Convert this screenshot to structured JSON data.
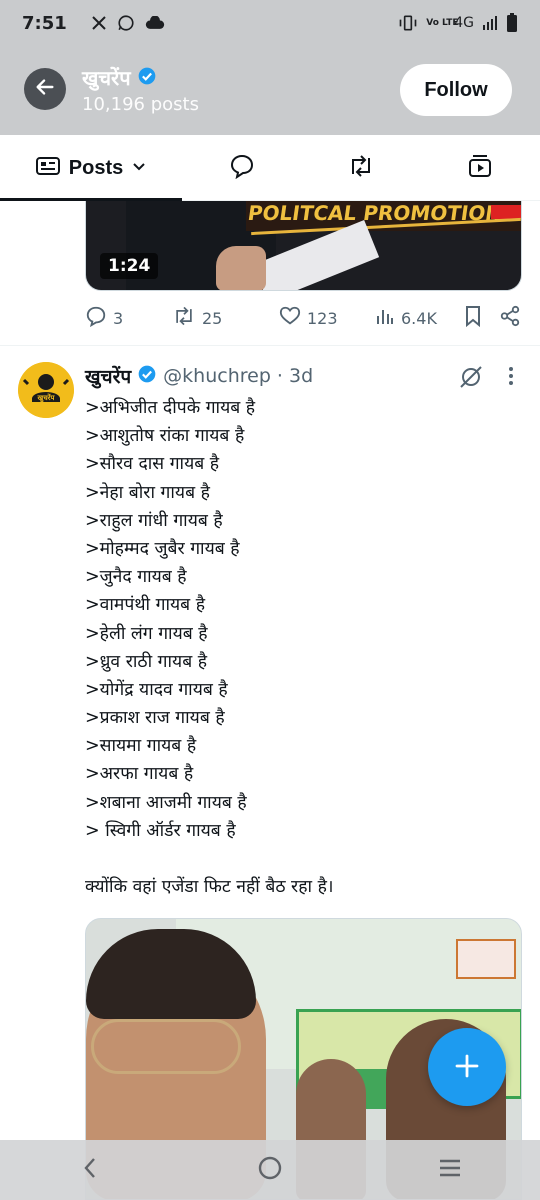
{
  "status_bar": {
    "time": "7:51",
    "left_icons": [
      "x-logo-icon",
      "whatsapp-icon",
      "cloud-icon"
    ],
    "volte": "Vo LTE",
    "network": "4G",
    "right_icons": [
      "vibrate-icon",
      "signal-icon",
      "battery-icon"
    ]
  },
  "header": {
    "name": "खुचरेंप",
    "posts_count": "10,196 posts",
    "follow_label": "Follow"
  },
  "tabs": {
    "posts_label": "Posts"
  },
  "video": {
    "banner_text": "POLITCAL PROMOTION",
    "duration": "1:24"
  },
  "actions": {
    "replies": "3",
    "reposts": "25",
    "likes": "123",
    "views": "6.4K"
  },
  "tweet": {
    "name": "खुचरेंप",
    "handle": "@khuchrep",
    "time": "· 3d",
    "avatar_text": "खुचरेंप",
    "lines": [
      ">अभिजीत दीपके गायब है",
      ">आशुतोष रांका गायब है",
      ">सौरव दास गायब है",
      ">नेहा बोरा गायब है",
      ">राहुल गांधी गायब है",
      ">मोहम्मद जुबैर गायब है",
      ">जुनैद गायब है",
      ">वामपंथी गायब है",
      ">हेली लंग गायब है",
      ">ध्रुव राठी गायब है",
      ">योगेंद्र यादव गायब है",
      ">प्रकाश राज गायब है",
      ">सायमा गायब है",
      ">अरफा गायब है",
      ">शबाना आजमी गायब है",
      "> स्विगी ऑर्डर गायब है"
    ],
    "closing": "क्योंकि वहां एजेंडा फिट नहीं बैठ रहा है।"
  },
  "colors": {
    "accent": "#1d9bf0",
    "muted": "#536471",
    "avatar_bg": "#f2bc1b"
  }
}
